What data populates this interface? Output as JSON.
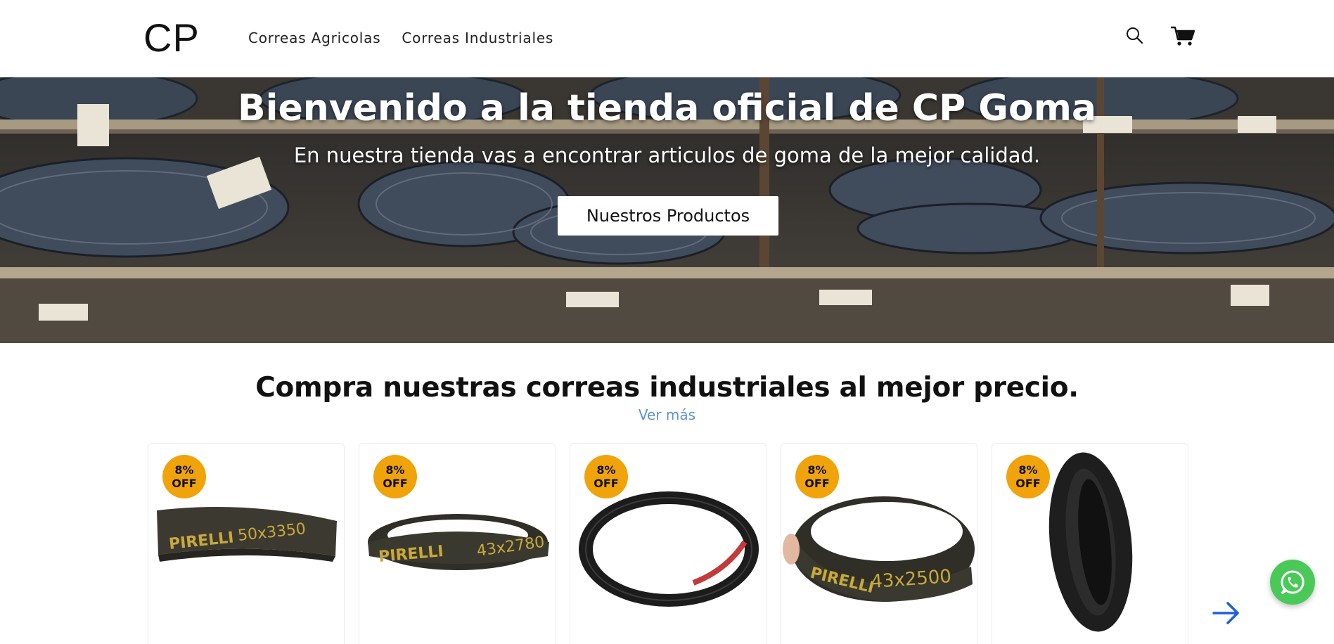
{
  "header": {
    "logo": "CP",
    "nav": [
      {
        "label": "Correas Agricolas"
      },
      {
        "label": "Correas Industriales"
      }
    ],
    "icons": {
      "search": "search-icon",
      "cart": "cart-icon"
    }
  },
  "hero": {
    "title": "Bienvenido a la tienda oficial de CP Goma",
    "subtitle": "En nuestra tienda vas a encontrar articulos de goma de la mejor calidad.",
    "button": "Nuestros Productos"
  },
  "section": {
    "title": "Compra nuestras correas industriales al mejor precio.",
    "link": "Ver más"
  },
  "products": [
    {
      "badge_pct": "8%",
      "badge_off": "OFF",
      "belt_text": "PIRELLI 50x3350"
    },
    {
      "badge_pct": "8%",
      "badge_off": "OFF",
      "belt_text": "PIRELLI 43x2780"
    },
    {
      "badge_pct": "8%",
      "badge_off": "OFF",
      "belt_text": ""
    },
    {
      "badge_pct": "8%",
      "badge_off": "OFF",
      "belt_text": "PIRELLI 43x2500"
    },
    {
      "badge_pct": "8%",
      "badge_off": "OFF",
      "belt_text": ""
    }
  ],
  "colors": {
    "badge": "#f0a30a",
    "link": "#5b8fd9",
    "whatsapp": "#4ac959",
    "arrow": "#1d5fe0"
  }
}
